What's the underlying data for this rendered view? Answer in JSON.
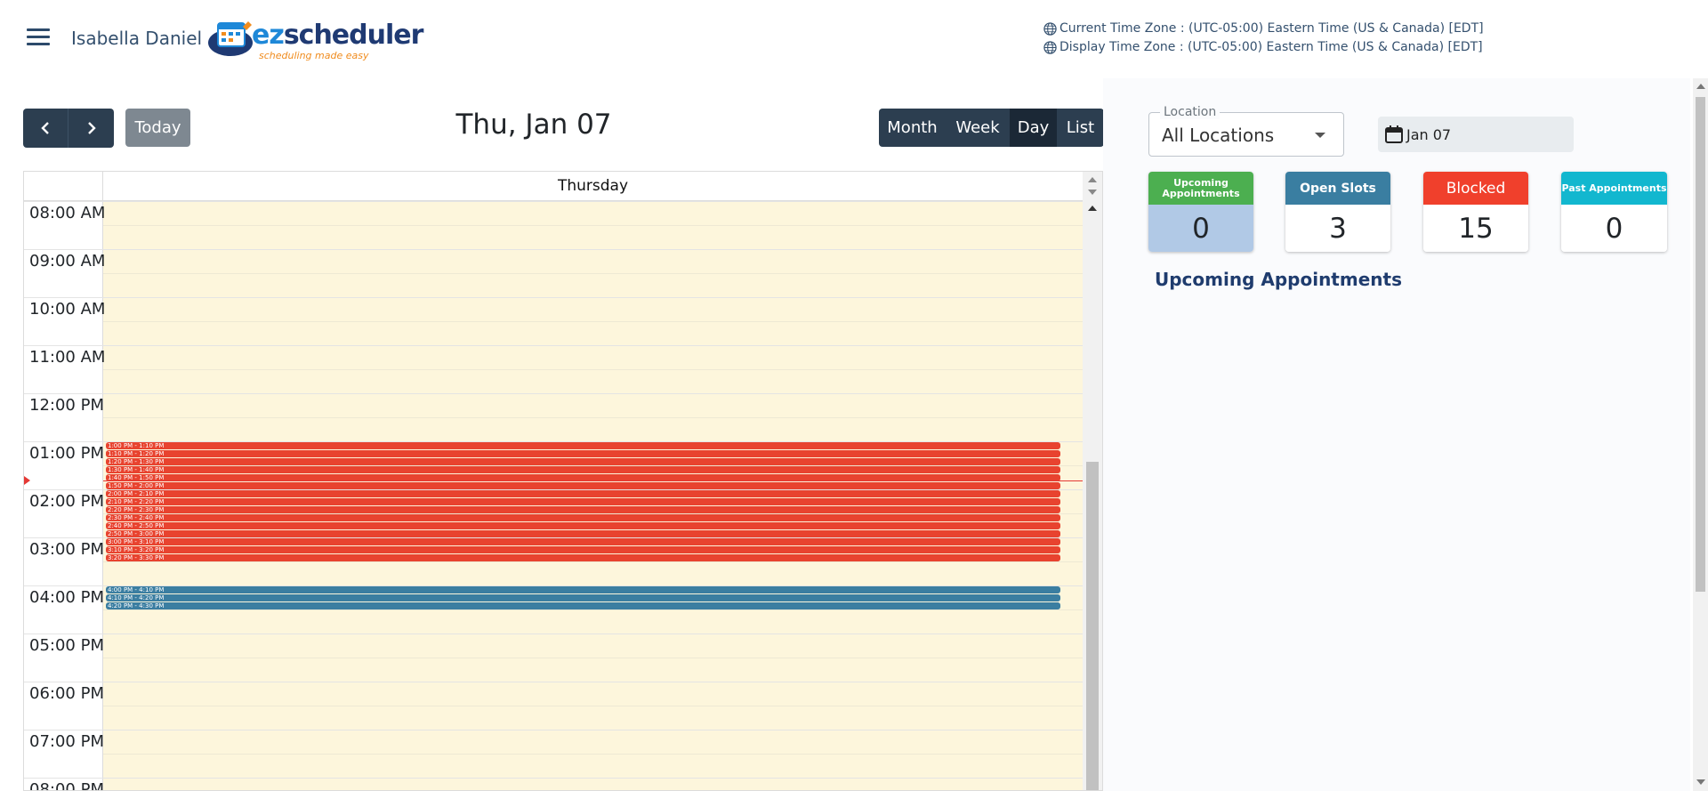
{
  "header": {
    "user_name": "Isabella Daniel",
    "logo": {
      "word_prefix": "ez",
      "word_suffix": "scheduler",
      "tagline": "scheduling made easy"
    },
    "current_tz": "Current Time Zone : (UTC-05:00) Eastern Time (US & Canada) [EDT]",
    "display_tz": "Display Time Zone : (UTC-05:00) Eastern Time (US & Canada) [EDT]"
  },
  "toolbar": {
    "prev_icon": "chevron-left-icon",
    "next_icon": "chevron-right-icon",
    "today_label": "Today",
    "title": "Thu, Jan 07",
    "views": [
      {
        "label": "Month",
        "active": false
      },
      {
        "label": "Week",
        "active": false
      },
      {
        "label": "Day",
        "active": true
      },
      {
        "label": "List",
        "active": false
      }
    ]
  },
  "calendar": {
    "day_header": "Thursday",
    "hours": [
      "08:00 AM",
      "09:00 AM",
      "10:00 AM",
      "11:00 AM",
      "12:00 PM",
      "01:00 PM",
      "02:00 PM",
      "03:00 PM",
      "04:00 PM",
      "05:00 PM",
      "06:00 PM",
      "07:00 PM",
      "08:00 PM"
    ],
    "blocked_events": [
      "1:00 PM - 1:10 PM",
      "1:10 PM - 1:20 PM",
      "1:20 PM - 1:30 PM",
      "1:30 PM - 1:40 PM",
      "1:40 PM - 1:50 PM",
      "1:50 PM - 2:00 PM",
      "2:00 PM - 2:10 PM",
      "2:10 PM - 2:20 PM",
      "2:20 PM - 2:30 PM",
      "2:30 PM - 2:40 PM",
      "2:40 PM - 2:50 PM",
      "2:50 PM - 3:00 PM",
      "3:00 PM - 3:10 PM",
      "3:10 PM - 3:20 PM",
      "3:20 PM - 3:30 PM"
    ],
    "open_events": [
      "4:00 PM - 4:10 PM",
      "4:10 PM - 4:20 PM",
      "4:20 PM - 4:30 PM"
    ],
    "colors": {
      "blocked": "#e8432f",
      "open": "#3b7ea1",
      "day_bg": "#fdf6dc",
      "now_line": "#e53935"
    }
  },
  "filters": {
    "location_legend": "Location",
    "location_value": "All Locations",
    "date_value": "Jan 07"
  },
  "stats": [
    {
      "label": "Upcoming Appointments",
      "value": "0",
      "head_color": "#4caf50",
      "body_color": "#b1c9e6"
    },
    {
      "label": "Open Slots",
      "value": "3",
      "head_color": "#3a7ea1",
      "body_color": "#ffffff"
    },
    {
      "label": "Blocked",
      "value": "15",
      "head_color": "#f0402c",
      "body_color": "#ffffff"
    },
    {
      "label": "Past Appointments",
      "value": "0",
      "head_color": "#12b7cf",
      "body_color": "#ffffff"
    }
  ],
  "upcoming_title": "Upcoming Appointments"
}
